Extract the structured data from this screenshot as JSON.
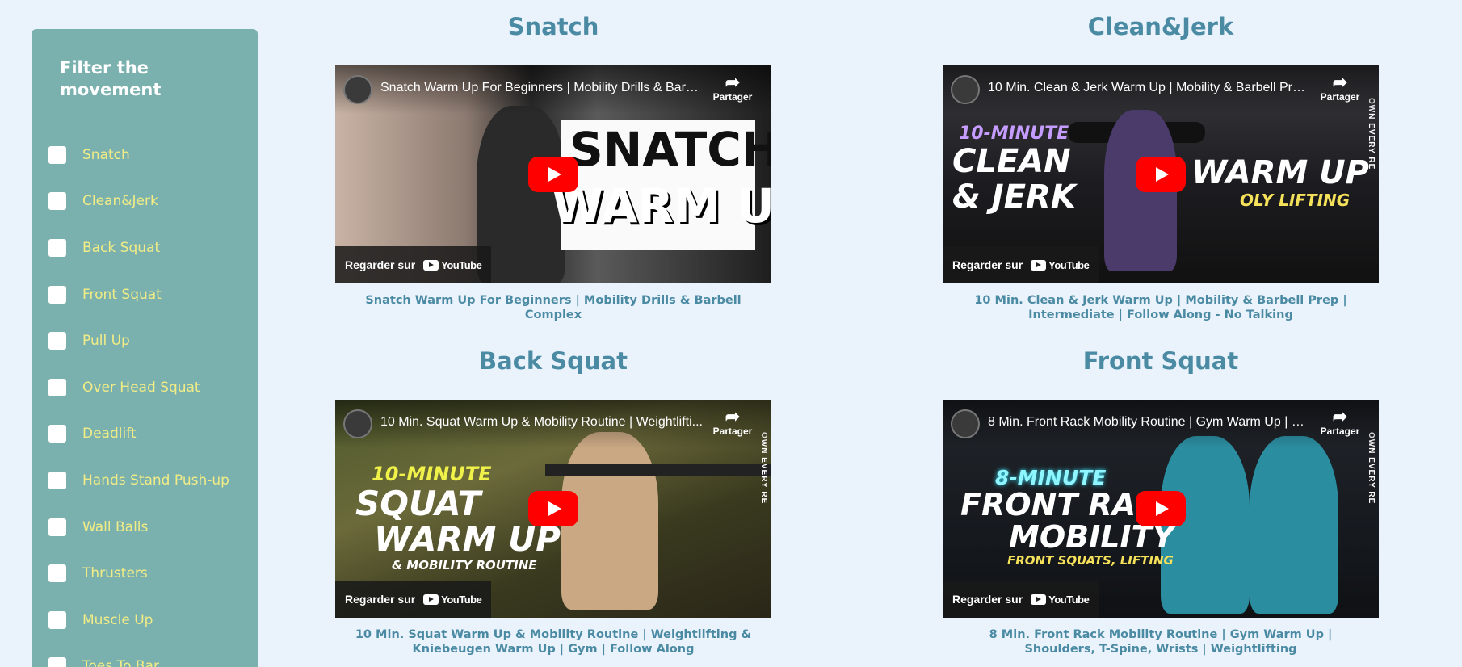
{
  "sidebar": {
    "title": "Filter the movement",
    "items": [
      {
        "label": "Snatch"
      },
      {
        "label": "Clean&Jerk"
      },
      {
        "label": "Back Squat"
      },
      {
        "label": "Front Squat"
      },
      {
        "label": "Pull Up"
      },
      {
        "label": "Over Head Squat"
      },
      {
        "label": "Deadlift"
      },
      {
        "label": "Hands Stand Push-up"
      },
      {
        "label": "Wall Balls"
      },
      {
        "label": "Thrusters"
      },
      {
        "label": "Muscle Up"
      },
      {
        "label": "Toes To Bar"
      }
    ]
  },
  "player": {
    "share_label": "Partager",
    "watch_on": "Regarder sur",
    "youtube": "YouTube"
  },
  "cards": [
    {
      "heading": "Snatch",
      "video_title": "Snatch Warm Up For Beginners | Mobility Drills & Barbe...",
      "caption": "Snatch Warm Up For Beginners | Mobility Drills & Barbell Complex",
      "thumb_line1": "SNATCH",
      "thumb_line2": "WARM UP"
    },
    {
      "heading": "Clean&Jerk",
      "video_title": "10 Min. Clean & Jerk Warm Up | Mobility & Barbell Prep...",
      "caption": "10 Min. Clean & Jerk Warm Up | Mobility & Barbell Prep | Intermediate | Follow Along - No Talking",
      "thumb_line1": "10-MINUTE",
      "thumb_line2": "CLEAN",
      "thumb_line3": "& JERK",
      "thumb_line4": "WARM UP",
      "thumb_line5": "OLY LIFTING",
      "side_text": "OWN EVERY RE"
    },
    {
      "heading": "Back Squat",
      "video_title": "10 Min. Squat Warm Up & Mobility Routine | Weightlifti...",
      "caption": "10 Min. Squat Warm Up & Mobility Routine | Weightlifting & Kniebeugen Warm Up | Gym | Follow Along",
      "thumb_line1": "10-MINUTE",
      "thumb_line2": "SQUAT",
      "thumb_line3": "WARM UP",
      "thumb_line4": "& MOBILITY ROUTINE",
      "side_text": "OWN EVERY RE"
    },
    {
      "heading": "Front Squat",
      "video_title": "8 Min. Front Rack Mobility Routine | Gym Warm Up | Sh...",
      "caption": "8 Min. Front Rack Mobility Routine | Gym Warm Up | Shoulders, T-Spine, Wrists | Weightlifting",
      "thumb_line1": "8-MINUTE",
      "thumb_line2": "FRONT RACK",
      "thumb_line3": "MOBILITY",
      "thumb_line4": "FRONT SQUATS, LIFTING",
      "side_text": "OWN EVERY RE"
    }
  ],
  "colors": {
    "background": "#eaf3fc",
    "sidebar": "#7ab1ae",
    "label": "#f1ec86",
    "heading": "#4a8aa3",
    "play": "#ff0000"
  }
}
